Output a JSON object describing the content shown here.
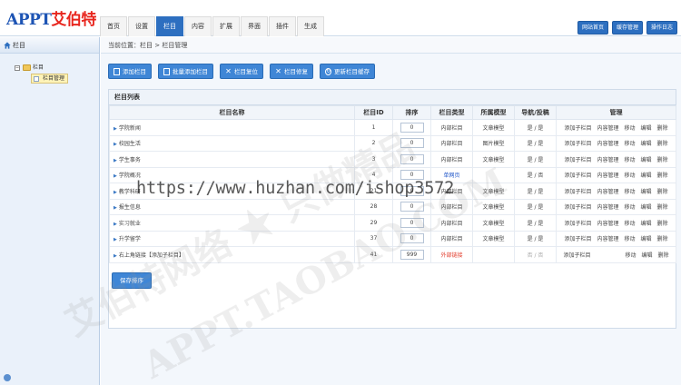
{
  "logo": {
    "brand": "APPT",
    "cn": "艾伯特"
  },
  "nav": [
    "首页",
    "设置",
    "栏目",
    "内容",
    "扩展",
    "界面",
    "插件",
    "生成"
  ],
  "nav_active": 2,
  "top_buttons": [
    "网站首页",
    "缓存管理",
    "操作日志"
  ],
  "sidebar": {
    "title": "栏目",
    "tree_root": "栏目",
    "tree_child": "栏目管理"
  },
  "breadcrumb": "当前位置：栏目 > 栏目管理",
  "toolbar": {
    "add": "添加栏目",
    "batch_add": "批量添加栏目",
    "reset": "栏目复位",
    "repair": "栏目修复",
    "update_cache": "更新栏目缓存"
  },
  "panel_title": "栏目列表",
  "table": {
    "headers": [
      "栏目名称",
      "栏目ID",
      "排序",
      "栏目类型",
      "所属模型",
      "导航/投稿",
      "管理"
    ],
    "rows": [
      {
        "name": "学院新闻",
        "id": "1",
        "order": "0",
        "type": "内部栏目",
        "model": "文章模型",
        "nav": "是 / 是",
        "ops": [
          "添加子栏目",
          "内容管理",
          "移动",
          "编辑",
          "删除"
        ]
      },
      {
        "name": "校园生活",
        "id": "2",
        "order": "0",
        "type": "内部栏目",
        "model": "图片模型",
        "nav": "是 / 是",
        "ops": [
          "添加子栏目",
          "内容管理",
          "移动",
          "编辑",
          "删除"
        ]
      },
      {
        "name": "学生事务",
        "id": "3",
        "order": "0",
        "type": "内部栏目",
        "model": "文章模型",
        "nav": "是 / 是",
        "ops": [
          "添加子栏目",
          "内容管理",
          "移动",
          "编辑",
          "删除"
        ]
      },
      {
        "name": "学院概况",
        "id": "4",
        "order": "0",
        "type": "单网页",
        "model": "",
        "nav": "是 / 否",
        "ops": [
          "添加子栏目",
          "内容管理",
          "移动",
          "编辑",
          "删除"
        ]
      },
      {
        "name": "教学科研",
        "id": "21",
        "order": "0",
        "type": "内部栏目",
        "model": "文章模型",
        "nav": "是 / 是",
        "ops": [
          "添加子栏目",
          "内容管理",
          "移动",
          "编辑",
          "删除"
        ]
      },
      {
        "name": "报生信息",
        "id": "28",
        "order": "0",
        "type": "内部栏目",
        "model": "文章模型",
        "nav": "是 / 是",
        "ops": [
          "添加子栏目",
          "内容管理",
          "移动",
          "编辑",
          "删除"
        ]
      },
      {
        "name": "实习就业",
        "id": "29",
        "order": "0",
        "type": "内部栏目",
        "model": "文章模型",
        "nav": "是 / 是",
        "ops": [
          "添加子栏目",
          "内容管理",
          "移动",
          "编辑",
          "删除"
        ]
      },
      {
        "name": "升学留学",
        "id": "37",
        "order": "0",
        "type": "内部栏目",
        "model": "文章模型",
        "nav": "是 / 是",
        "ops": [
          "添加子栏目",
          "内容管理",
          "移动",
          "编辑",
          "删除"
        ]
      },
      {
        "name": "右上角链接【添加子栏目】",
        "id": "41",
        "order": "999",
        "type": "外部链接",
        "model": "",
        "nav": "否 / 否",
        "ops": [
          "添加子栏目",
          "",
          "移动",
          "编辑",
          "删除"
        ]
      }
    ]
  },
  "save_button": "保存排序",
  "watermark_url": "https://www.huzhan.com/ishop3572",
  "watermark_cn_1": "艾伯特网络 ★ 只做精品",
  "watermark_cn_2": "APPT.TAOBAO.COM",
  "colors": {
    "primary": "#2d6fc0",
    "button": "#3f86d6",
    "link_red": "#e23b2a",
    "single_page_blue": "#1f56c9"
  }
}
